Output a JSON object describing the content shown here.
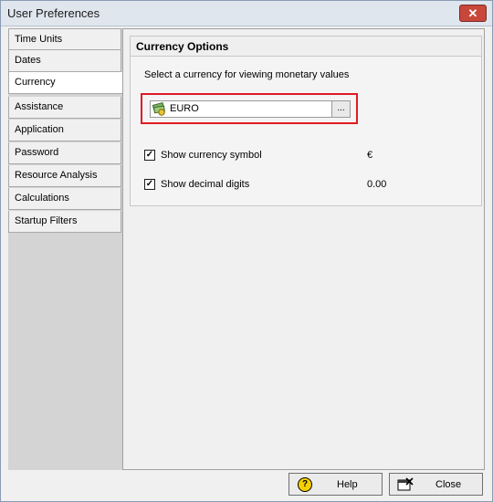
{
  "window": {
    "title": "User Preferences",
    "close_glyph": "✕"
  },
  "nav": {
    "items": [
      {
        "label": "Time Units",
        "active": false
      },
      {
        "label": "Dates",
        "active": false
      },
      {
        "label": "Currency",
        "active": true
      },
      {
        "label": "Assistance",
        "active": false
      },
      {
        "label": "Application",
        "active": false
      },
      {
        "label": "Password",
        "active": false
      },
      {
        "label": "Resource Analysis",
        "active": false
      },
      {
        "label": "Calculations",
        "active": false
      },
      {
        "label": "Startup Filters",
        "active": false
      }
    ]
  },
  "currency_options": {
    "header": "Currency Options",
    "instruction": "Select a currency for viewing monetary values",
    "selected_currency": "EURO",
    "browse_label": "...",
    "icon": "money-icon",
    "show_symbol": {
      "label": "Show currency symbol",
      "checked": true,
      "value": "€"
    },
    "show_decimals": {
      "label": "Show decimal digits",
      "checked": true,
      "value": "0.00"
    },
    "highlight_color": "#e01b24"
  },
  "buttons": {
    "help": {
      "label": "Help",
      "icon": "help-icon"
    },
    "close": {
      "label": "Close",
      "icon": "close-window-icon"
    }
  }
}
